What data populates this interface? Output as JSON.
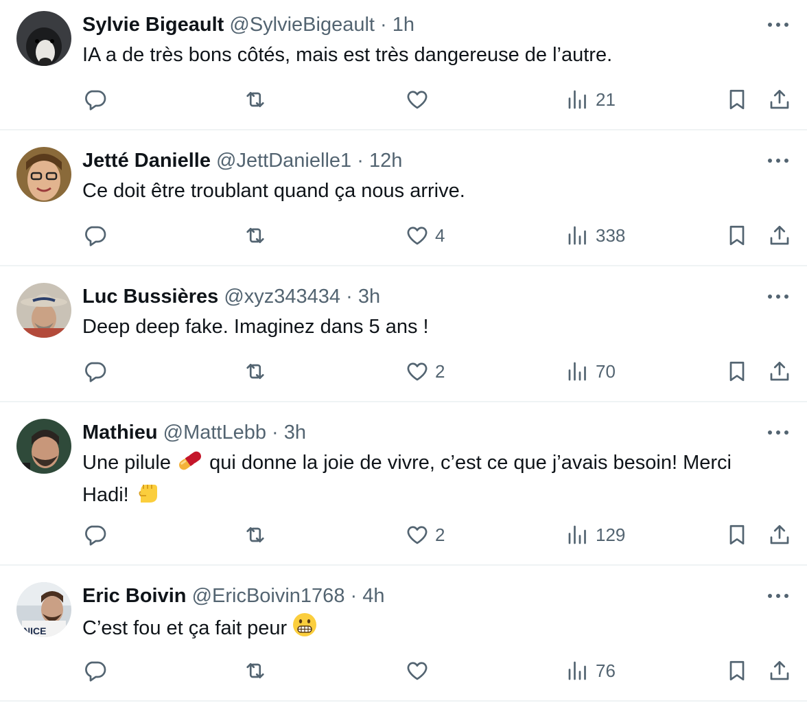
{
  "icons": {
    "reply": "reply-icon",
    "retweet": "retweet-icon",
    "like": "heart-icon",
    "views": "views-icon",
    "bookmark": "bookmark-icon",
    "share": "share-icon",
    "more": "more-icon"
  },
  "replies": [
    {
      "name": "Sylvie Bigeault",
      "handle": "@SylvieBigeault",
      "dot": "·",
      "time": "1h",
      "text": "IA a de très bons côtés, mais est très dangereuse de l’autre.",
      "likes": "",
      "views": "21"
    },
    {
      "name": "Jetté Danielle",
      "handle": "@JettDanielle1",
      "dot": "·",
      "time": "12h",
      "text": "Ce doit être troublant quand ça nous arrive.",
      "likes": "4",
      "views": "338"
    },
    {
      "name": "Luc Bussières",
      "handle": "@xyz343434",
      "dot": "·",
      "time": "3h",
      "text": "Deep deep fake. Imaginez dans 5 ans !",
      "likes": "2",
      "views": "70"
    },
    {
      "name": "Mathieu",
      "handle": "@MattLebb",
      "dot": "·",
      "time": "3h",
      "text_part1": "Une pilule",
      "text_part2": "qui donne la joie de vivre, c’est ce que j’avais besoin! Merci Hadi!",
      "likes": "2",
      "views": "129"
    },
    {
      "name": "Eric Boivin",
      "handle": "@EricBoivin1768",
      "dot": "·",
      "time": "4h",
      "text": "C’est fou et ça fait peur",
      "likes": "",
      "views": "76"
    }
  ]
}
